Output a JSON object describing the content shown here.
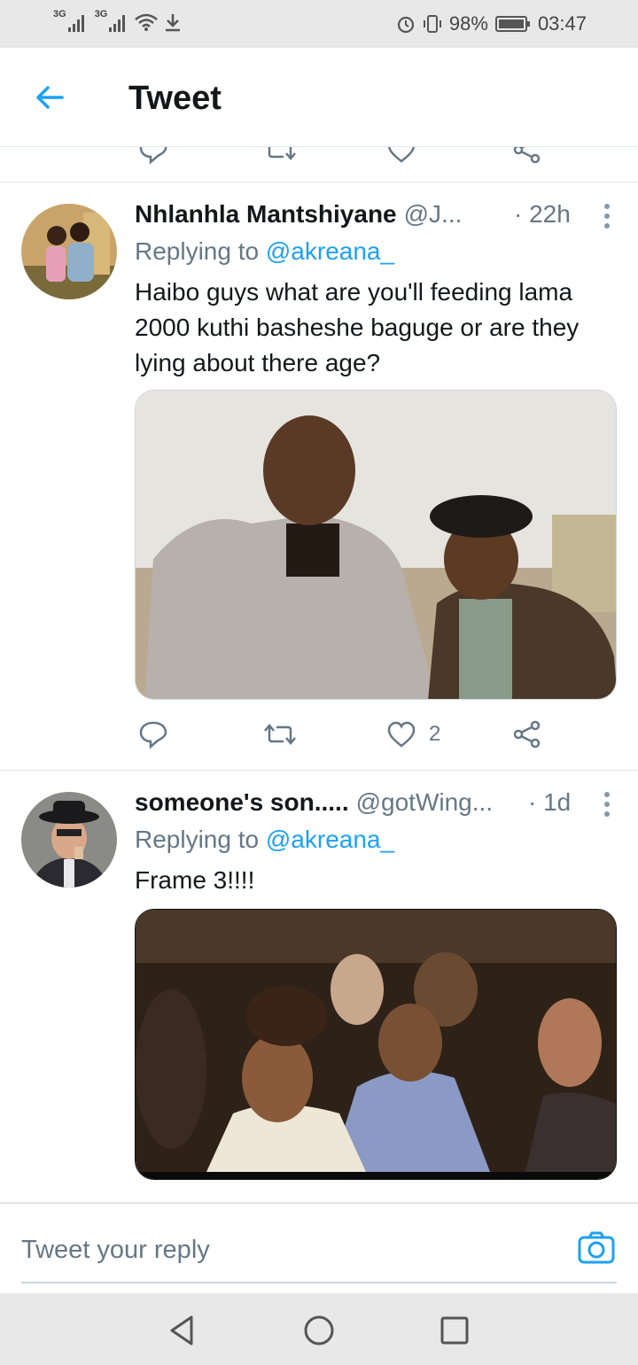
{
  "status_bar": {
    "network_1": "3G",
    "network_2": "3G",
    "battery": "98%",
    "time": "03:47"
  },
  "header": {
    "title": "Tweet"
  },
  "tweets": [
    {
      "name": "Nhlanhla Mantshiyane",
      "handle": "@J...",
      "time": "· 22h",
      "replying_prefix": "Replying to ",
      "replying_to": "@akreana_",
      "text": "Haibo guys what are you'll feeding lama 2000 kuthi basheshe baguge or are they lying about there age?",
      "like_count": "2"
    },
    {
      "name": "someone's son.....",
      "handle": "@gotWing...",
      "time": "· 1d",
      "replying_prefix": "Replying to ",
      "replying_to": "@akreana_",
      "text": "Frame 3!!!!"
    }
  ],
  "reply_bar": {
    "placeholder": "Tweet your reply"
  },
  "colors": {
    "accent": "#1da1f2",
    "secondary_text": "#657786",
    "primary_text": "#14171a",
    "divider": "#e1e8ed"
  },
  "icons": [
    "back-arrow-icon",
    "reply-icon",
    "retweet-icon",
    "like-icon",
    "share-icon",
    "more-icon",
    "camera-icon",
    "wifi-icon",
    "download-icon",
    "alarm-icon",
    "vibrate-icon",
    "battery-icon",
    "nav-back-icon",
    "nav-home-icon",
    "nav-recents-icon"
  ]
}
